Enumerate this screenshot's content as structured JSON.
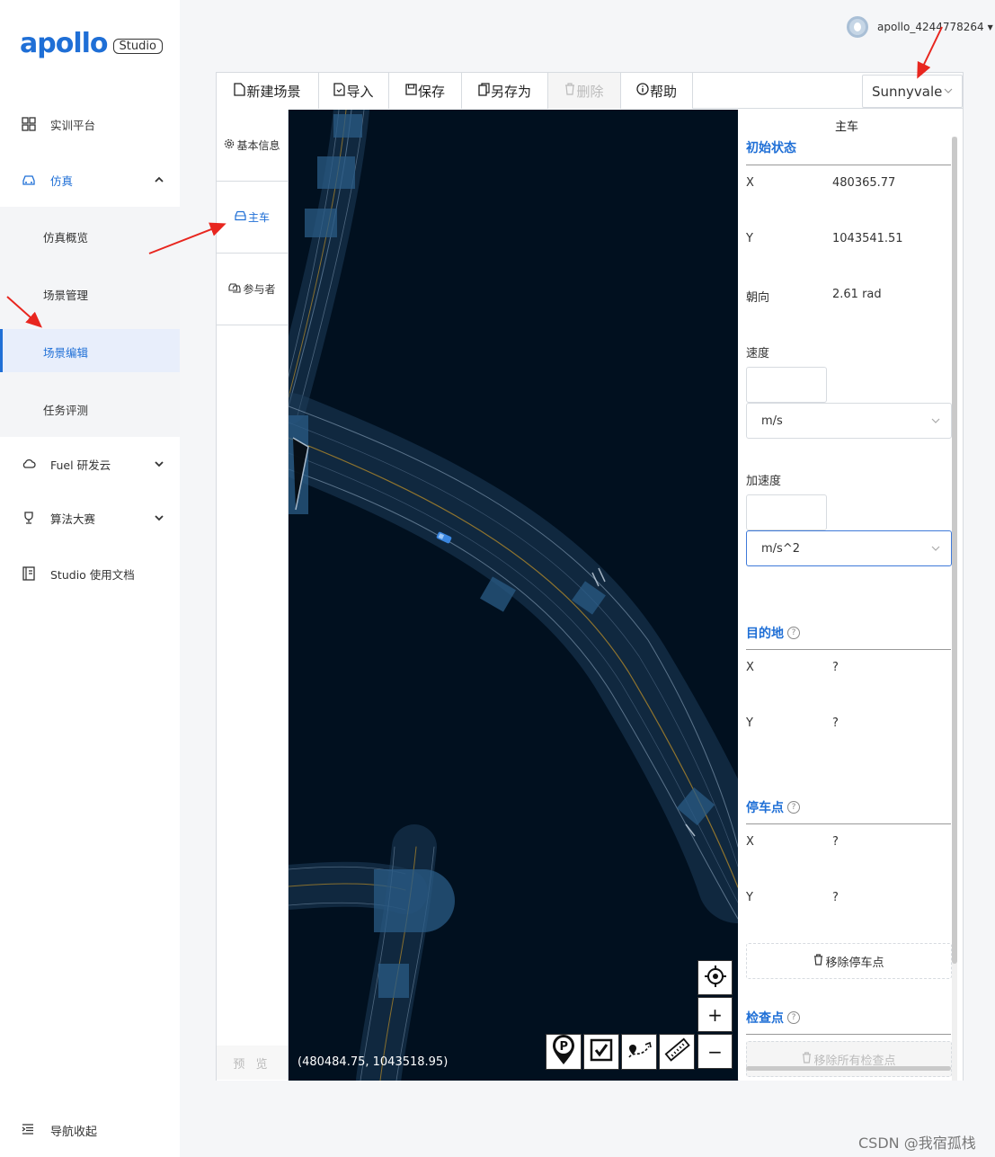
{
  "app": {
    "logo_text": "apollo",
    "logo_badge": "Studio"
  },
  "user": {
    "name": "apollo_4244778264"
  },
  "sidebar": {
    "items": [
      {
        "label": "实训平台",
        "icon": "dashboard-icon"
      },
      {
        "label": "仿真",
        "icon": "simulation-car-icon",
        "expanded": true
      },
      {
        "label": "Fuel 研发云",
        "icon": "cloud-icon"
      },
      {
        "label": "算法大赛",
        "icon": "trophy-icon"
      },
      {
        "label": "Studio 使用文档",
        "icon": "book-icon"
      }
    ],
    "sub_items": [
      {
        "label": "仿真概览"
      },
      {
        "label": "场景管理"
      },
      {
        "label": "场景编辑",
        "active": true
      },
      {
        "label": "任务评测"
      }
    ],
    "collapse_label": "导航收起"
  },
  "toolbar": {
    "new_scene": "新建场景",
    "import": "导入",
    "save": "保存",
    "save_as": "另存为",
    "delete": "删除",
    "help": "帮助",
    "map_selected": "Sunnyvale"
  },
  "left_tabs": {
    "basic_info": "基本信息",
    "ego_car": "主车",
    "participants": "参与者",
    "preview": "预 览"
  },
  "map": {
    "coordinates": "(480484.75, 1043518.95)",
    "zoom_in": "+",
    "zoom_out": "−"
  },
  "panel": {
    "title": "主车",
    "initial_state": {
      "title": "初始状态",
      "x_label": "X",
      "x_value": "480365.77",
      "y_label": "Y",
      "y_value": "1043541.51",
      "heading_label": "朝向",
      "heading_value": "2.61 rad",
      "speed_label": "速度",
      "speed_value": "",
      "speed_unit": "m/s",
      "accel_label": "加速度",
      "accel_value": "",
      "accel_unit": "m/s^2"
    },
    "destination": {
      "title": "目的地",
      "x_label": "X",
      "x_value": "?",
      "y_label": "Y",
      "y_value": "?"
    },
    "parking": {
      "title": "停车点",
      "x_label": "X",
      "x_value": "?",
      "y_label": "Y",
      "y_value": "?",
      "remove_button": "移除停车点"
    },
    "checkpoint": {
      "title": "检查点",
      "remove_all_button": "移除所有检查点"
    }
  },
  "watermark": "CSDN @我宿孤栈",
  "colors": {
    "accent": "#1f6fd6",
    "map_background": "#01101f",
    "annotation_arrow": "#e8261f"
  }
}
